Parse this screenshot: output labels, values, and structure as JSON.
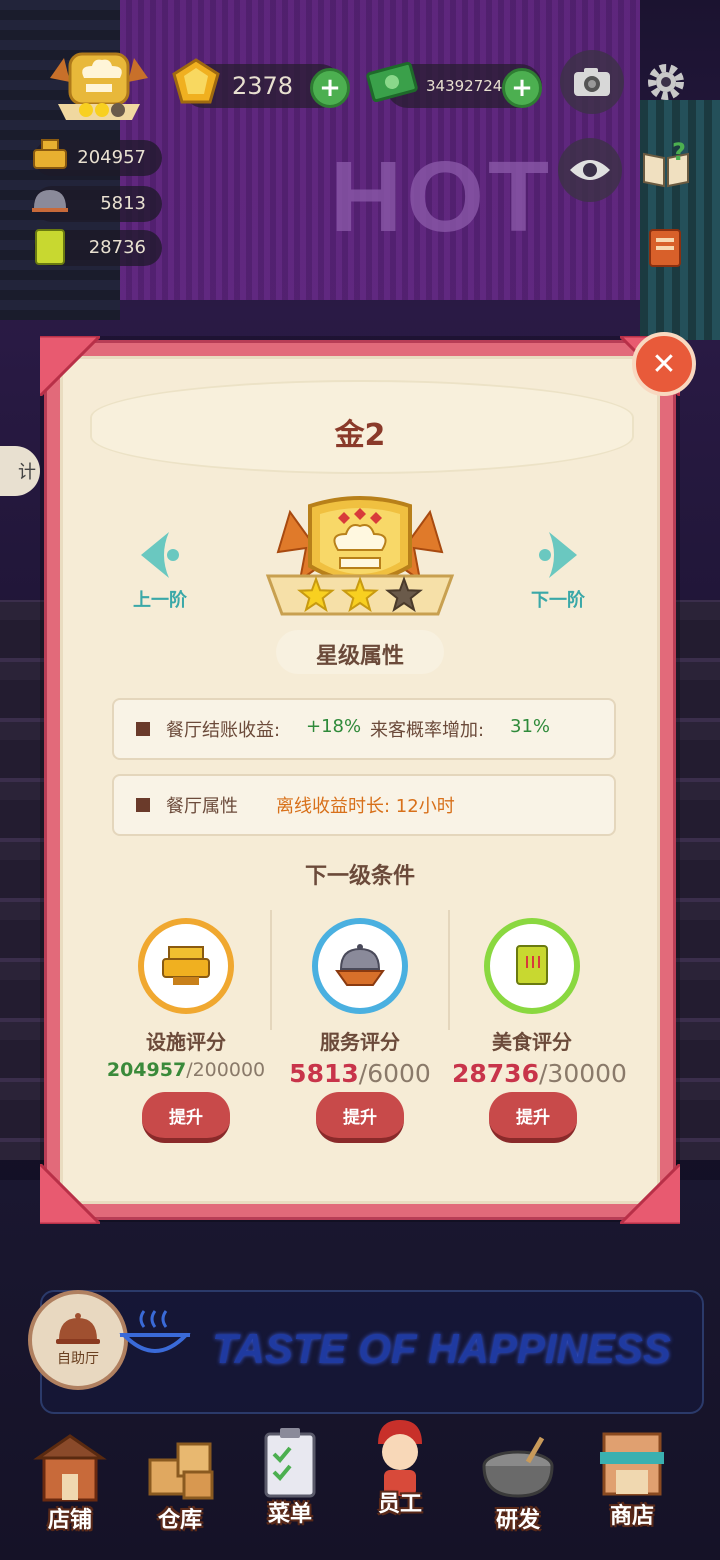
{
  "hud": {
    "gems": "2378",
    "cash": "34392724",
    "facility_score": "204957",
    "service_score": "5813",
    "food_score": "28736"
  },
  "background": {
    "sign_text": "HOT",
    "banner_text": "TASTE OF HAPPINESS",
    "buffet_label": "自助厅",
    "side_text": "计"
  },
  "modal": {
    "title": "金2",
    "prev_label": "上一阶",
    "next_label": "下一阶",
    "star_section_title": "星级属性",
    "stars_filled": 2,
    "stars_total": 3,
    "attr1": {
      "label1": "餐厅结账收益:",
      "value1": "+18%",
      "label2": "来客概率增加:",
      "value2": "31%"
    },
    "attr2": {
      "label": "餐厅属性",
      "detail": "离线收益时长: 12小时"
    },
    "next_level_title": "下一级条件",
    "conditions": [
      {
        "label": "设施评分",
        "current": "204957",
        "target": "/200000",
        "button": "提升",
        "current_color": "#3a8a3a"
      },
      {
        "label": "服务评分",
        "current": "5813",
        "target": "/6000",
        "button": "提升",
        "current_color": "#c8344a"
      },
      {
        "label": "美食评分",
        "current": "28736",
        "target": "/30000",
        "button": "提升",
        "current_color": "#c8344a"
      }
    ]
  },
  "bottom_nav": [
    {
      "label": "店铺"
    },
    {
      "label": "仓库"
    },
    {
      "label": "菜单"
    },
    {
      "label": "员工"
    },
    {
      "label": "研发"
    },
    {
      "label": "商店"
    }
  ]
}
